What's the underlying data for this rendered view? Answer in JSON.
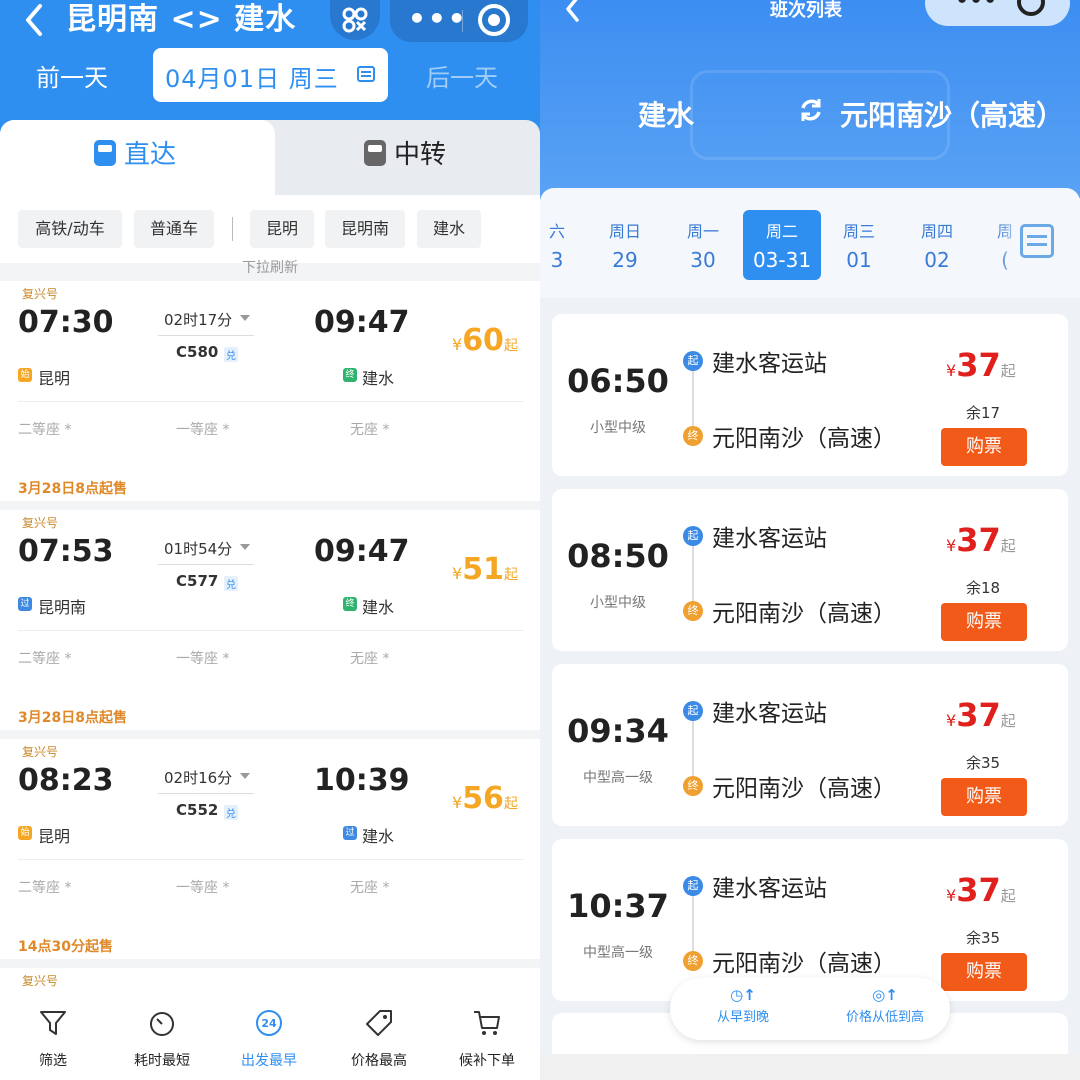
{
  "left": {
    "header": {
      "title": "昆明南 <> 建水",
      "prev_day": "前一天",
      "date": "04月01日 周三",
      "next_day": "后一天",
      "menu_dots": "•••"
    },
    "tabs": {
      "direct": "直达",
      "transfer": "中转"
    },
    "filters": [
      "高铁/动车",
      "普通车",
      "昆明",
      "昆明南",
      "建水"
    ],
    "pull_hint": "下拉刷新",
    "trains": [
      {
        "tag": "复兴号",
        "dep_time": "07:30",
        "duration": "02时17分",
        "code": "C580",
        "code_badge": "兑",
        "arr_time": "09:47",
        "from_badge": "始",
        "from": "昆明",
        "to_badge": "终",
        "to": "建水",
        "price_symbol": "¥",
        "price": "60",
        "price_suffix": "起",
        "seats": [
          "二等座 *",
          "一等座 *",
          "无座 *"
        ],
        "sale_note": "3月28日8点起售"
      },
      {
        "tag": "复兴号",
        "dep_time": "07:53",
        "duration": "01时54分",
        "code": "C577",
        "code_badge": "兑",
        "arr_time": "09:47",
        "from_badge": "过",
        "from": "昆明南",
        "to_badge": "终",
        "to": "建水",
        "price_symbol": "¥",
        "price": "51",
        "price_suffix": "起",
        "seats": [
          "二等座 *",
          "一等座 *",
          "无座 *"
        ],
        "sale_note": "3月28日8点起售"
      },
      {
        "tag": "复兴号",
        "dep_time": "08:23",
        "duration": "02时16分",
        "code": "C552",
        "code_badge": "兑",
        "arr_time": "10:39",
        "from_badge": "始",
        "from": "昆明",
        "to_badge": "过",
        "to": "建水",
        "price_symbol": "¥",
        "price": "56",
        "price_suffix": "起",
        "seats": [
          "二等座 *",
          "一等座 *",
          "无座 *"
        ],
        "sale_note": "14点30分起售"
      }
    ],
    "partial_tag": "复兴号",
    "bottom_bar": [
      {
        "label": "筛选",
        "icon": "filter-icon"
      },
      {
        "label": "耗时最短",
        "icon": "timer-icon"
      },
      {
        "label": "出发最早",
        "icon": "clock-24-icon",
        "active": true
      },
      {
        "label": "价格最高",
        "icon": "price-tag-icon"
      },
      {
        "label": "候补下单",
        "icon": "cart-icon"
      }
    ],
    "colors": {
      "brand_blue": "#2f8ff0",
      "price_orange": "#f5a623",
      "sale_orange": "#e0892a"
    }
  },
  "right": {
    "header": {
      "title": "班次列表",
      "from": "建水",
      "to": "元阳南沙（高速）"
    },
    "days": [
      {
        "week": "六",
        "date": "3"
      },
      {
        "week": "周日",
        "date": "29"
      },
      {
        "week": "周一",
        "date": "30"
      },
      {
        "week": "周二",
        "date": "03-31",
        "active": true
      },
      {
        "week": "周三",
        "date": "01"
      },
      {
        "week": "周四",
        "date": "02"
      },
      {
        "week": "周",
        "date": "("
      }
    ],
    "buses": [
      {
        "time": "06:50",
        "type": "小型中级",
        "from_badge": "起",
        "from": "建水客运站",
        "to_badge": "终",
        "to": "元阳南沙（高速）",
        "price_symbol": "¥",
        "price": "37",
        "price_suffix": "起",
        "remaining": "余17",
        "buy": "购票"
      },
      {
        "time": "08:50",
        "type": "小型中级",
        "from_badge": "起",
        "from": "建水客运站",
        "to_badge": "终",
        "to": "元阳南沙（高速）",
        "price_symbol": "¥",
        "price": "37",
        "price_suffix": "起",
        "remaining": "余18",
        "buy": "购票"
      },
      {
        "time": "09:34",
        "type": "中型高一级",
        "from_badge": "起",
        "from": "建水客运站",
        "to_badge": "终",
        "to": "元阳南沙（高速）",
        "price_symbol": "¥",
        "price": "37",
        "price_suffix": "起",
        "remaining": "余35",
        "buy": "购票"
      },
      {
        "time": "10:37",
        "type": "中型高一级",
        "from_badge": "起",
        "from": "建水客运站",
        "to_badge": "终",
        "to": "元阳南沙（高速）",
        "price_symbol": "¥",
        "price": "37",
        "price_suffix": "起",
        "remaining": "余35",
        "buy": "购票"
      }
    ],
    "sort": [
      {
        "label": "从早到晚",
        "icon": "time-up-icon"
      },
      {
        "label": "价格从低到高",
        "icon": "price-up-icon"
      }
    ],
    "colors": {
      "header_blue": "#3c8ef2",
      "price_red": "#e0201c",
      "buy_orange": "#f15a18"
    }
  }
}
